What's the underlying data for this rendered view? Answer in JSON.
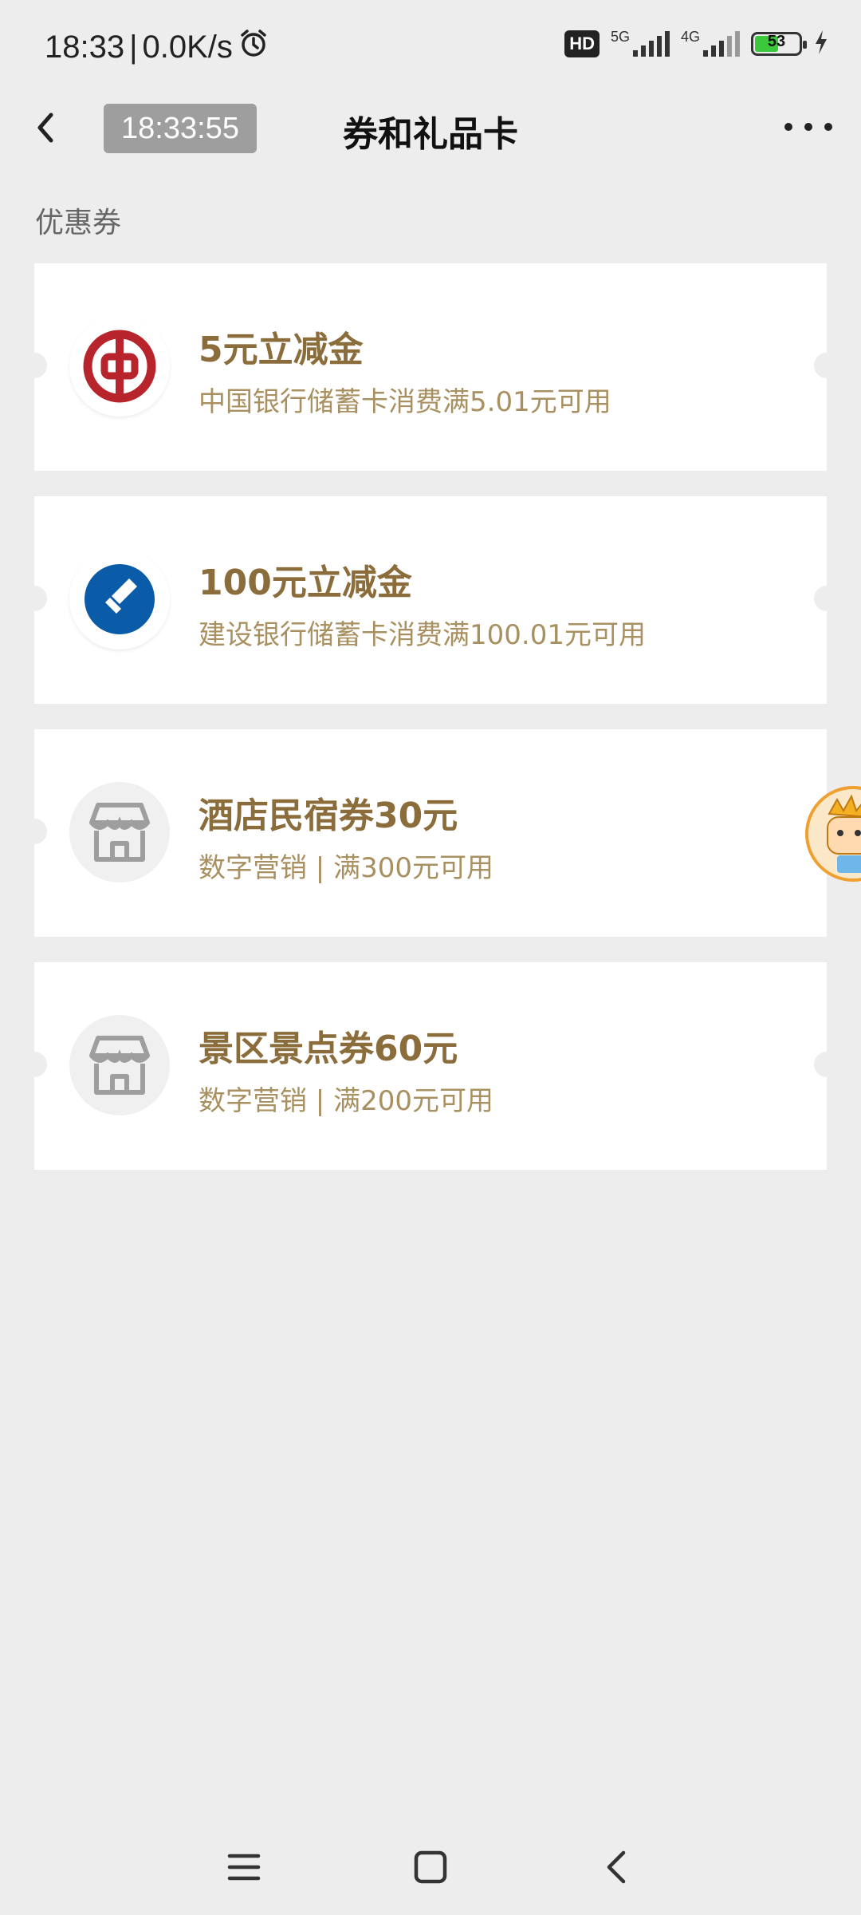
{
  "status_bar": {
    "time": "18:33",
    "separator": "|",
    "speed": "0.0K/s",
    "hd_label": "HD",
    "sim1_network": "5G",
    "sim2_network": "4G",
    "battery_level": "53",
    "battery_percent": 53,
    "battery_color": "#3BC83B"
  },
  "header": {
    "time_badge": "18:33:55",
    "title": "券和礼品卡"
  },
  "section": {
    "title": "优惠券"
  },
  "coupons": [
    {
      "title": "5元立减金",
      "desc": "中国银行储蓄卡消费满5.01元可用",
      "icon": "boc-logo-icon"
    },
    {
      "title": "100元立减金",
      "desc": "建设银行储蓄卡消费满100.01元可用",
      "icon": "ccb-logo-icon"
    },
    {
      "title": "酒店民宿券30元",
      "desc": "数字营销 | 满300元可用",
      "icon": "store-icon"
    },
    {
      "title": "景区景点券60元",
      "desc": "数字营销 | 满200元可用",
      "icon": "store-icon"
    }
  ],
  "colors": {
    "title_gold": "#8A6D3B",
    "desc_gold": "#A89060",
    "boc_red": "#B8242B",
    "ccb_blue": "#0A5BA8",
    "background": "#EDEDED"
  }
}
